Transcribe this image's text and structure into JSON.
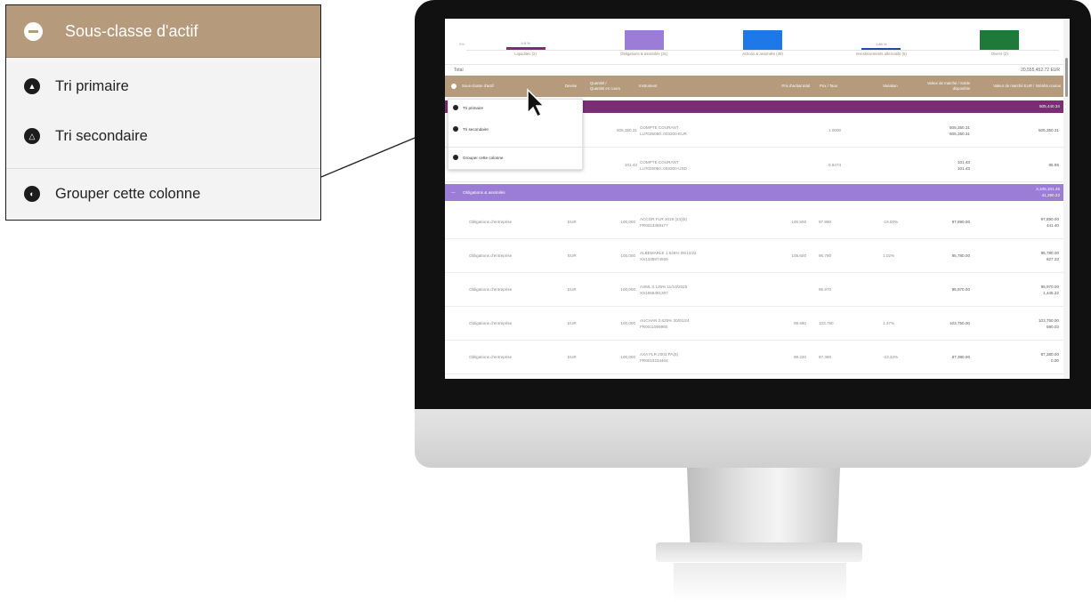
{
  "callout": {
    "header": "Sous-classe d'actif",
    "items": [
      {
        "label": "Tri primaire",
        "glyph": "▲"
      },
      {
        "label": "Tri secondaire",
        "glyph": "△"
      },
      {
        "label": "Grouper cette colonne",
        "glyph": "◐"
      }
    ]
  },
  "chart_data": {
    "type": "bar",
    "categories": [
      "Liquidités (2)",
      "Obligations & assimilés (31)",
      "Actions & assimilés (49)",
      "Investissements alternatifs (5)",
      "Divers (2)"
    ],
    "values_label": [
      "4.8 %",
      "",
      "",
      "1.86 %",
      ""
    ],
    "colors": [
      "#7b2d74",
      "#9b7cd6",
      "#1f78e8",
      "#1a4f9c",
      "#1f7a3a"
    ],
    "relative_heights": [
      0.14,
      1.0,
      1.0,
      0.1,
      1.0
    ],
    "ytick": "0%"
  },
  "total": {
    "label": "Total",
    "value": "20,555,452.72 EUR"
  },
  "columns": {
    "sub_class": "Sous-classe d'actif",
    "currency": "Devise",
    "quantity": "Quantité / Quantité en cours",
    "instrument": "Instrument",
    "avg_price": "Prix d'achat total",
    "price": "Prix / Taux",
    "variation": "Variation",
    "market_value": "Valeur de marché / Solde disponible",
    "market_value_eur": "Valeur de marché EUR / Intérêts courus"
  },
  "dropdown": {
    "primary": "Tri primaire",
    "secondary": "Tri secondaire",
    "group": "Grouper cette colonne"
  },
  "group_liquidity": {
    "value": "505,440.34"
  },
  "cash_rows": [
    {
      "qty": "505,350.31",
      "instrument": "COMPTE COURANT",
      "code": "LU7025050..003200-EUR",
      "price": "1.0000",
      "mv": "505,350.31",
      "mv2": "505,350.31",
      "eur": "505,350.31"
    },
    {
      "qty": "101.43",
      "instrument": "COMPTE COURANT",
      "code": "LU7025050..003200-USD",
      "price": "0.8474",
      "mv": "101.43",
      "mv2": "101.43",
      "eur": "85.95"
    }
  ],
  "group_bonds": {
    "label": "Obligations & assimilés",
    "value": "3,105,101.45",
    "value2": "41,290.22",
    "icon": "—"
  },
  "bond_rows": [
    {
      "sub": "Obligations d'entreprise",
      "cur": "EUR",
      "qty": "100,000",
      "instrument": "ACCOR FLR 2019 (24)(5)",
      "code": "FR0013399177",
      "avg": "100.500",
      "price": "97.890",
      "var": "-16.00%",
      "mv": "97,890.00",
      "eur": "97,890.00",
      "eur2": "441.40"
    },
    {
      "sub": "Obligations d'entreprise",
      "cur": "EUR",
      "qty": "100,000",
      "instrument": "ALBEMARLE 1.625% 09/12/22",
      "code": "XS1348874929",
      "avg": "105.600",
      "price": "95.780",
      "var": "1.02%",
      "mv": "95,780.00",
      "eur": "95,780.00",
      "eur2": "827.23"
    },
    {
      "sub": "Obligations d'entreprise",
      "cur": "EUR",
      "qty": "100,000",
      "instrument": "ASML 0.125% 11/10/2025",
      "code": "XS1556491307",
      "avg": "",
      "price": "95.970",
      "var": "",
      "mv": "95,970.00",
      "eur": "95,970.00",
      "eur2": "1,445.22"
    },
    {
      "sub": "Obligations d'entreprise",
      "cur": "EUR",
      "qty": "100,000",
      "instrument": "AUCHAN 2.625% 30/01/24",
      "code": "FR0011599960",
      "avg": "99.680",
      "price": "103.750",
      "var": "1.37%",
      "mv": "103,750.00",
      "eur": "103,750.00",
      "eur2": "590.03"
    },
    {
      "sub": "Obligations d'entreprise",
      "cur": "EUR",
      "qty": "100,000",
      "instrument": "AXA FLR 2003 PA(5)",
      "code": "FR0010234404",
      "avg": "98.220",
      "price": "97.380",
      "var": "-23.32%",
      "mv": "87,380.00",
      "eur": "87,380.00",
      "eur2": "0.00"
    }
  ]
}
